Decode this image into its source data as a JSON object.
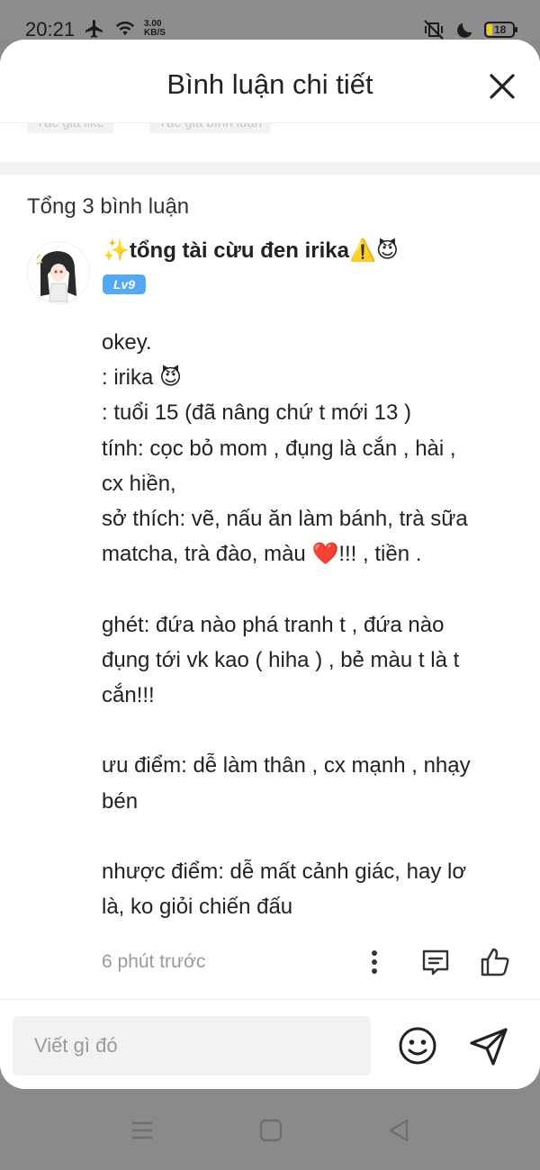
{
  "status_bar": {
    "time": "20:21",
    "speed_value": "3.00",
    "speed_unit": "KB/S",
    "battery": "18",
    "icons": [
      "airplane-icon",
      "wifi-icon",
      "mute-vibrate-icon",
      "moon-icon",
      "battery-icon"
    ]
  },
  "sheet": {
    "title": "Bình luận chi tiết",
    "peek_chips": [
      "Tác giả like",
      "Tác giả bình luận"
    ]
  },
  "comments_section": {
    "count_label": "Tổng 3 bình luận",
    "comment": {
      "username": "✨tổng tài cừu đen irika⚠️😈",
      "level": "Lv9",
      "lines": [
        "okey.",
        ": irika 😈",
        ": tuổi 15 (đã nâng chứ t mới 13 )",
        "tính: cọc bỏ mom , đụng là cắn , hài ,",
        "cx hiền,",
        "sở thích: vẽ, nấu ăn làm bánh, trà sữa",
        "matcha, trà đào, màu ❤️!!! , tiền .",
        "",
        "ghét: đứa nào phá tranh t , đứa nào",
        "đụng tới vk kao ( hiha ) , bẻ màu t là t",
        "cắn!!!",
        "",
        "ưu điểm: dễ làm thân , cx mạnh , nhạy",
        "bén",
        "",
        "nhược điểm: dễ mất cảnh giác, hay lơ",
        "là, ko giỏi chiến đấu"
      ],
      "timestamp": "6 phút trước"
    }
  },
  "input_bar": {
    "placeholder": "Viết gì đó"
  },
  "colors": {
    "level_badge": "#54a8f5",
    "overlay": "#8a8a8a",
    "input_bg": "#f2f2f2",
    "muted_text": "#9a9a9a"
  }
}
